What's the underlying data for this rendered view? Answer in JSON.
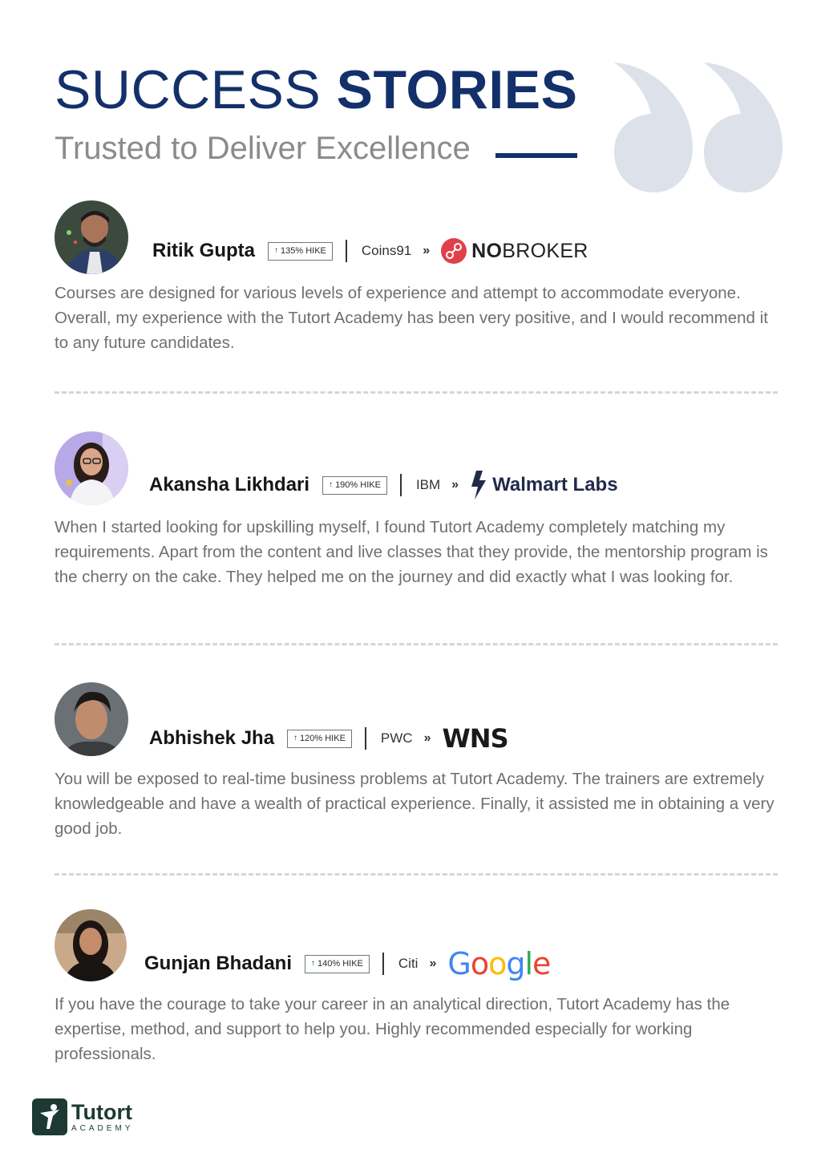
{
  "header": {
    "title_light": "SUCCESS",
    "title_bold": "STORIES",
    "subtitle": "Trusted to Deliver Excellence"
  },
  "stories": [
    {
      "name": "Ritik Gupta",
      "hike": "135% HIKE",
      "from_company": "Coins91",
      "to_company_a": "NO",
      "to_company_b": "BROKER",
      "testimonial": "Courses are designed for various levels of experience and attempt to accommodate everyone. Overall, my experience with the Tutort Academy has been very positive, and I would recommend it to any future candidates."
    },
    {
      "name": "Akansha Likhdari",
      "hike": "190% HIKE",
      "from_company": "IBM",
      "to_company": "Walmart Labs",
      "testimonial": "When I started looking for upskilling myself, I found Tutort Academy completely matching my requirements. Apart from the content and live classes that they provide, the mentorship program is the cherry on the cake. They helped me on the journey and did exactly what I was looking for."
    },
    {
      "name": "Abhishek Jha",
      "hike": "120% HIKE",
      "from_company": "PWC",
      "to_company": "WNS",
      "testimonial": "You will be exposed to real-time business problems at Tutort Academy. The trainers are extremely knowledgeable and have a wealth of practical experience. Finally, it assisted me in obtaining a very good job."
    },
    {
      "name": "Gunjan Bhadani",
      "hike": "140% HIKE",
      "from_company": "Citi",
      "to_company": "Google",
      "testimonial": "If you have the courage to take your career in an analytical direction, Tutort Academy has the expertise, method, and support to help you. Highly recommended especially for working professionals."
    }
  ],
  "symbols": {
    "hike_arrow": "↑",
    "chevron": "»"
  },
  "footer": {
    "brand_name": "Tutort",
    "brand_sub": "ACADEMY"
  },
  "colors": {
    "title_navy": "#13306a",
    "subtitle_gray": "#8b8b8b",
    "quote_mark": "#dde1ea",
    "nobroker_red": "#e0404a",
    "brand_green": "#1c3a33"
  },
  "icons": [
    "quote-mark-icon",
    "hike-arrow-icon",
    "nobroker-logo-icon",
    "walmart-spark-icon",
    "tutort-logo-icon"
  ]
}
